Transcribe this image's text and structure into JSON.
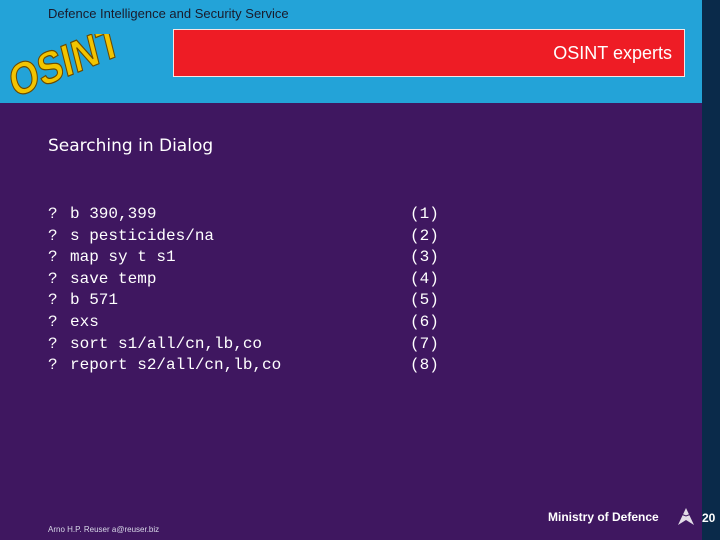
{
  "header": {
    "agency": "Defence Intelligence and Security Service",
    "banner": "OSINT experts",
    "logo_text": "OSINT"
  },
  "slide": {
    "title": "Searching in Dialog",
    "commands": [
      {
        "prompt": "?",
        "command": "b 390,399",
        "num": "(1)"
      },
      {
        "prompt": "?",
        "command": "s pesticides/na",
        "num": "(2)"
      },
      {
        "prompt": "?",
        "command": "map sy t s1",
        "num": "(3)"
      },
      {
        "prompt": "?",
        "command": "save temp",
        "num": "(4)"
      },
      {
        "prompt": "?",
        "command": "b 571",
        "num": "(5)"
      },
      {
        "prompt": "?",
        "command": "exs",
        "num": "(6)"
      },
      {
        "prompt": "?",
        "command": "sort s1/all/cn,lb,co",
        "num": "(7)"
      },
      {
        "prompt": "?",
        "command": "report s2/all/cn,lb,co",
        "num": "(8)"
      }
    ]
  },
  "footer": {
    "author": "Arno H.P. Reuser a@reuser.biz",
    "ministry": "Ministry of Defence",
    "page_number": "20"
  },
  "colors": {
    "header_bg": "#23a3d8",
    "slide_bg": "#3f1760",
    "banner_bg": "#ee1c25",
    "logo_fill": "#f2c400"
  }
}
